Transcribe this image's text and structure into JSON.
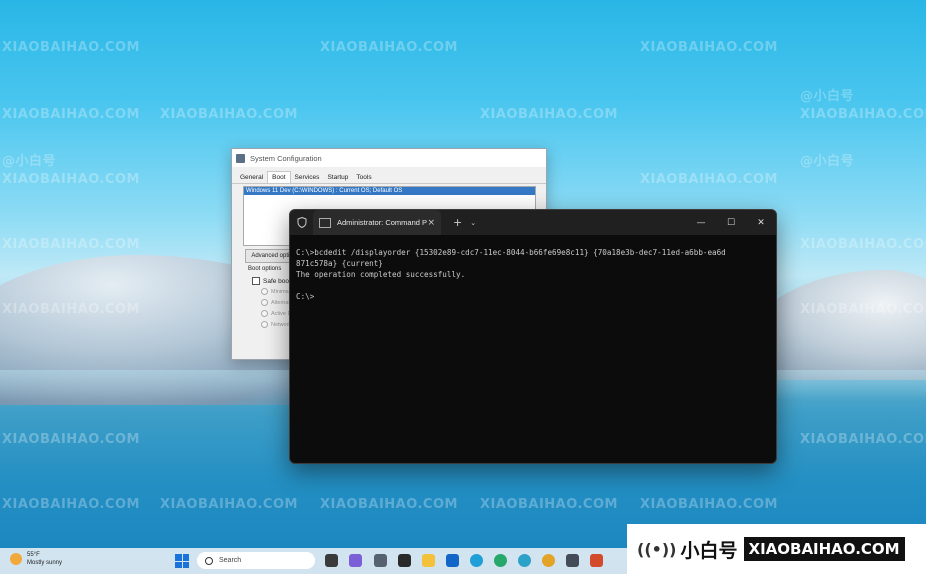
{
  "system_config": {
    "title": "System Configuration",
    "tabs": [
      "General",
      "Boot",
      "Services",
      "Startup",
      "Tools"
    ],
    "active_tab": "Boot",
    "os_entry": "Windows 11 Dev (C:\\WINDOWS) : Current OS; Default OS",
    "advanced_button": "Advanced optio",
    "boot_options_label": "Boot options",
    "safe_boot_label": "Safe boot",
    "safe_boot_checked": false,
    "radio_options": [
      "Minimal",
      "Alternat",
      "Active D",
      "Network"
    ]
  },
  "terminal": {
    "tab_title": "Administrator: Command Pro",
    "tab_close": "×",
    "new_tab": "+",
    "dropdown": "⌄",
    "window_controls": [
      "—",
      "☐",
      "✕"
    ],
    "lines": [
      "C:\\>bcdedit /displayorder {15302e89-cdc7-11ec-8044-b66fe69e8c11} {70a18e3b-dec7-11ed-a6bb-ea6d",
      "871c578a} {current}",
      "The operation completed successfully.",
      "",
      "C:\\>"
    ]
  },
  "taskbar": {
    "weather_temp": "55°F",
    "weather_desc": "Mostly sunny",
    "search_placeholder": "Search",
    "app_icons": [
      "chat-icon",
      "settings-icon",
      "terminal-icon",
      "file-explorer-icon",
      "outlook-icon",
      "edge-icon",
      "edge-beta-icon",
      "edge-dev-icon",
      "edge-canary-icon",
      "store-icon",
      "app-icon",
      "app-icon-2",
      "app-icon-3",
      "app-icon-4"
    ]
  },
  "banner": {
    "logo_text": "小白号",
    "site": "XIAOBAIHAO.COM"
  },
  "watermark": {
    "text": "XIAOBAIHAO.COM",
    "cn_text": "@小白号"
  }
}
